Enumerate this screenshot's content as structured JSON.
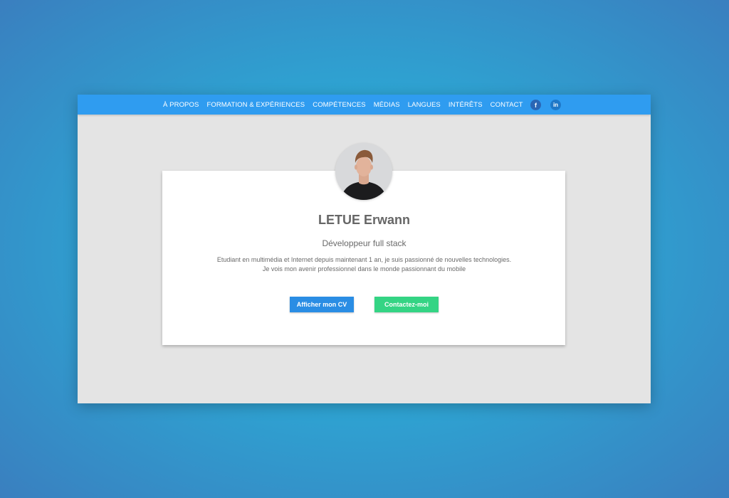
{
  "nav": {
    "items": [
      {
        "label": "À PROPOS"
      },
      {
        "label": "FORMATION & EXPÉRIENCES"
      },
      {
        "label": "COMPÉTENCES"
      },
      {
        "label": "MÉDIAS"
      },
      {
        "label": "LANGUES"
      },
      {
        "label": "INTÉRÊTS"
      },
      {
        "label": "CONTACT"
      }
    ],
    "socials": [
      {
        "icon": "facebook-icon",
        "glyph": "f"
      },
      {
        "icon": "linkedin-icon",
        "glyph": "in"
      }
    ]
  },
  "profile": {
    "name": "LETUE Erwann",
    "role": "Développeur full stack",
    "description_line1": "Etudiant en multimédia et Internet depuis maintenant 1 an, je suis passionné de nouvelles technologies.",
    "description_line2": "Je vois mon avenir professionnel dans le monde passionnant du mobile"
  },
  "buttons": {
    "cv_label": "Afficher mon CV",
    "contact_label": "Contactez-moi"
  },
  "colors": {
    "navbar": "#2f9cf0",
    "cv_button": "#2a8de4",
    "contact_button": "#34d484",
    "page_bg": "#e4e4e4"
  }
}
